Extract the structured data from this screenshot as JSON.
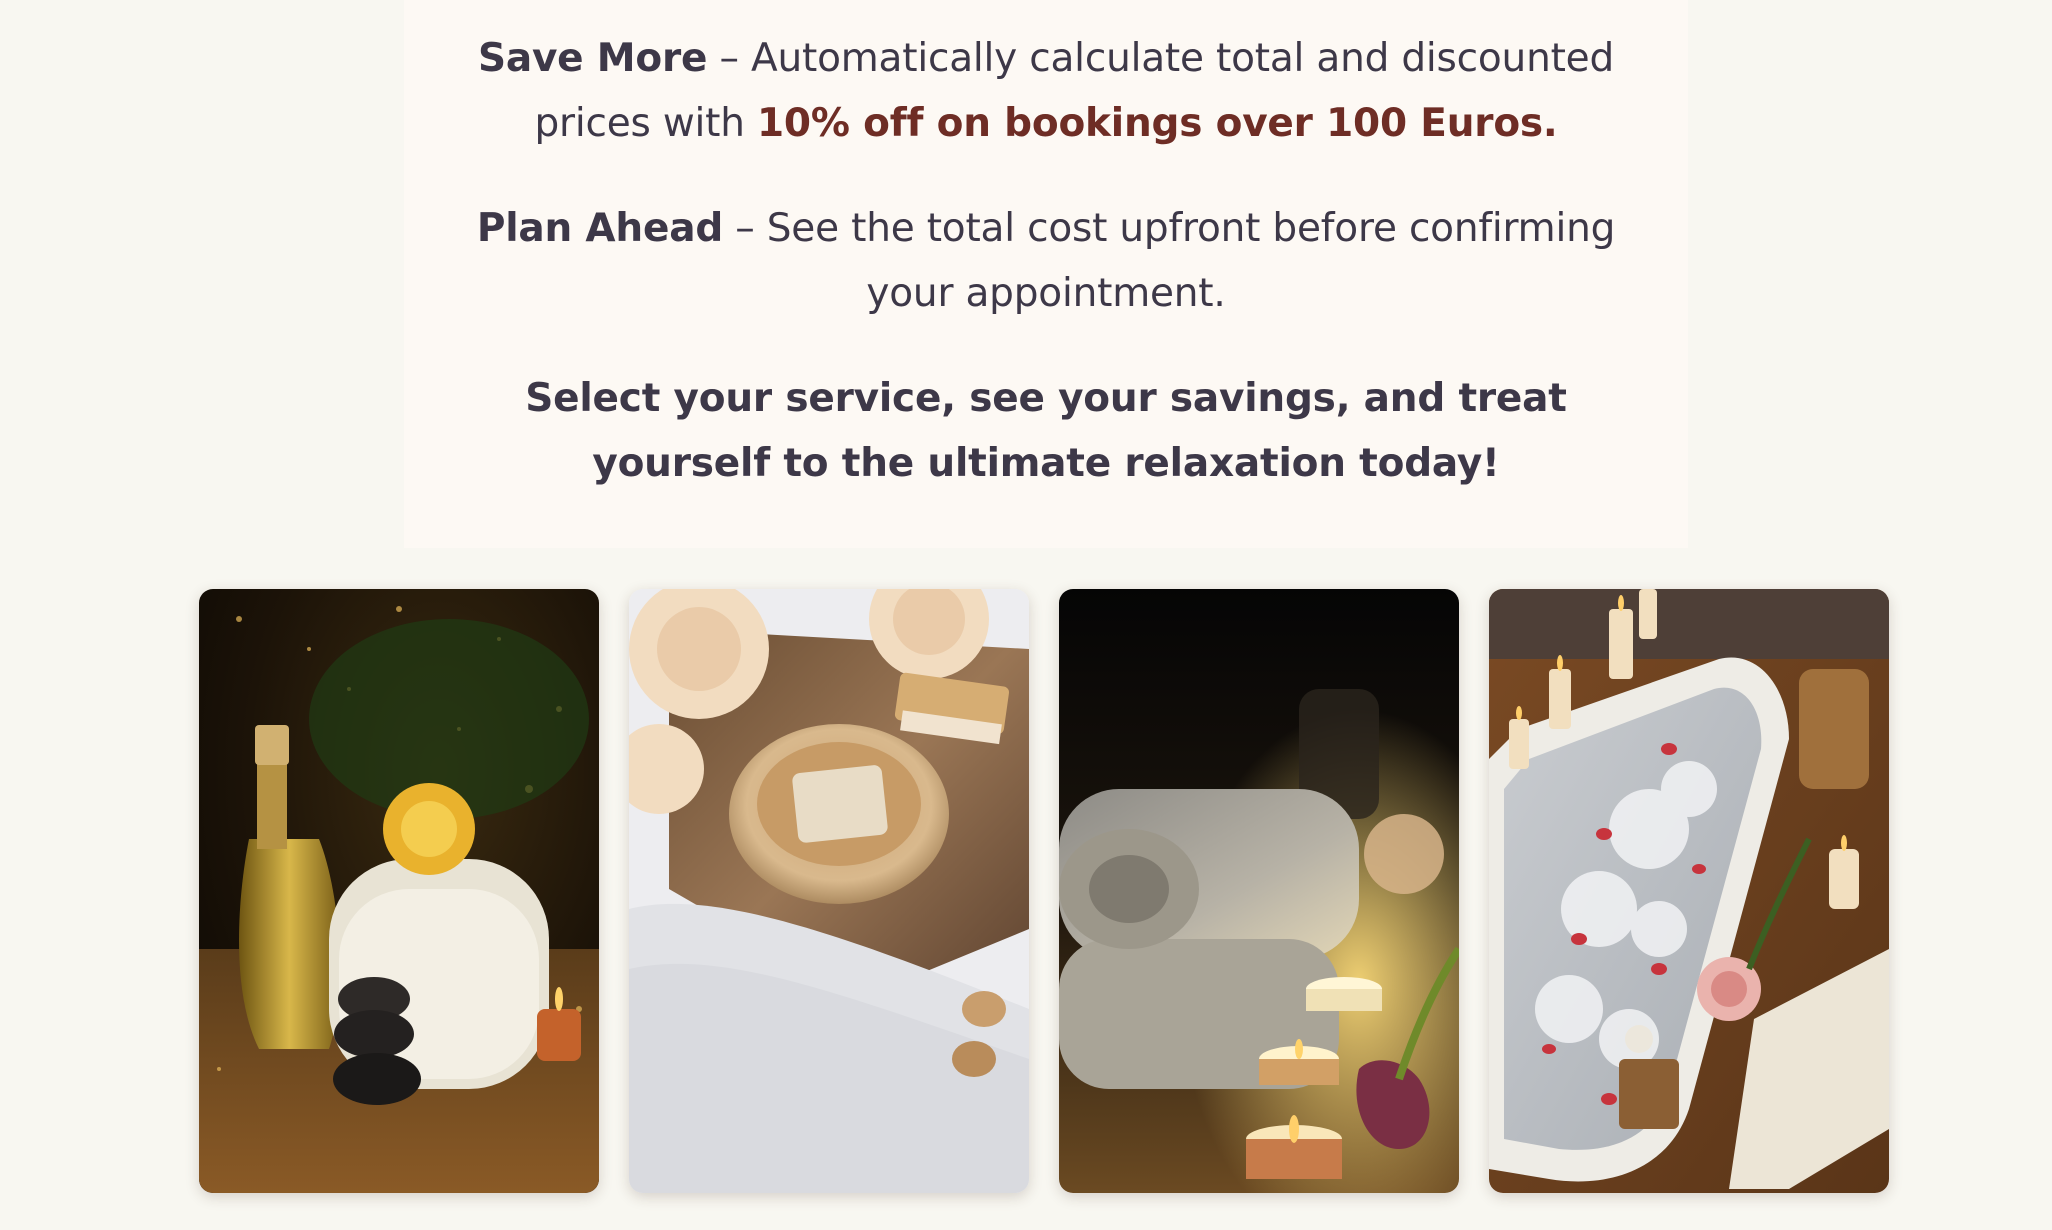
{
  "features": {
    "save_more": {
      "label": "Save More",
      "text": " – Automatically calculate total and discounted prices with ",
      "highlight": "10% off on bookings over 100 Euros."
    },
    "plan_ahead": {
      "label": "Plan Ahead",
      "text": " – See the total cost upfront before confirming your appointment."
    },
    "cta": "Select your service, see your savings, and treat yourself to the ultimate relaxation today!"
  },
  "colors": {
    "page_bg": "#f8f7f1",
    "panel_bg": "#fdf9f4",
    "text": "#3d3848",
    "accent": "#6e2d25"
  },
  "gallery": [
    {
      "name": "spa-oil-towel-photo",
      "icon": "oil-towel-candle-image"
    },
    {
      "name": "soap-dish-photo",
      "icon": "soap-flowers-towel-image"
    },
    {
      "name": "towels-candles-photo",
      "icon": "towels-candles-tulip-image"
    },
    {
      "name": "bathtub-petals-photo",
      "icon": "bathtub-rose-petals-image"
    }
  ]
}
